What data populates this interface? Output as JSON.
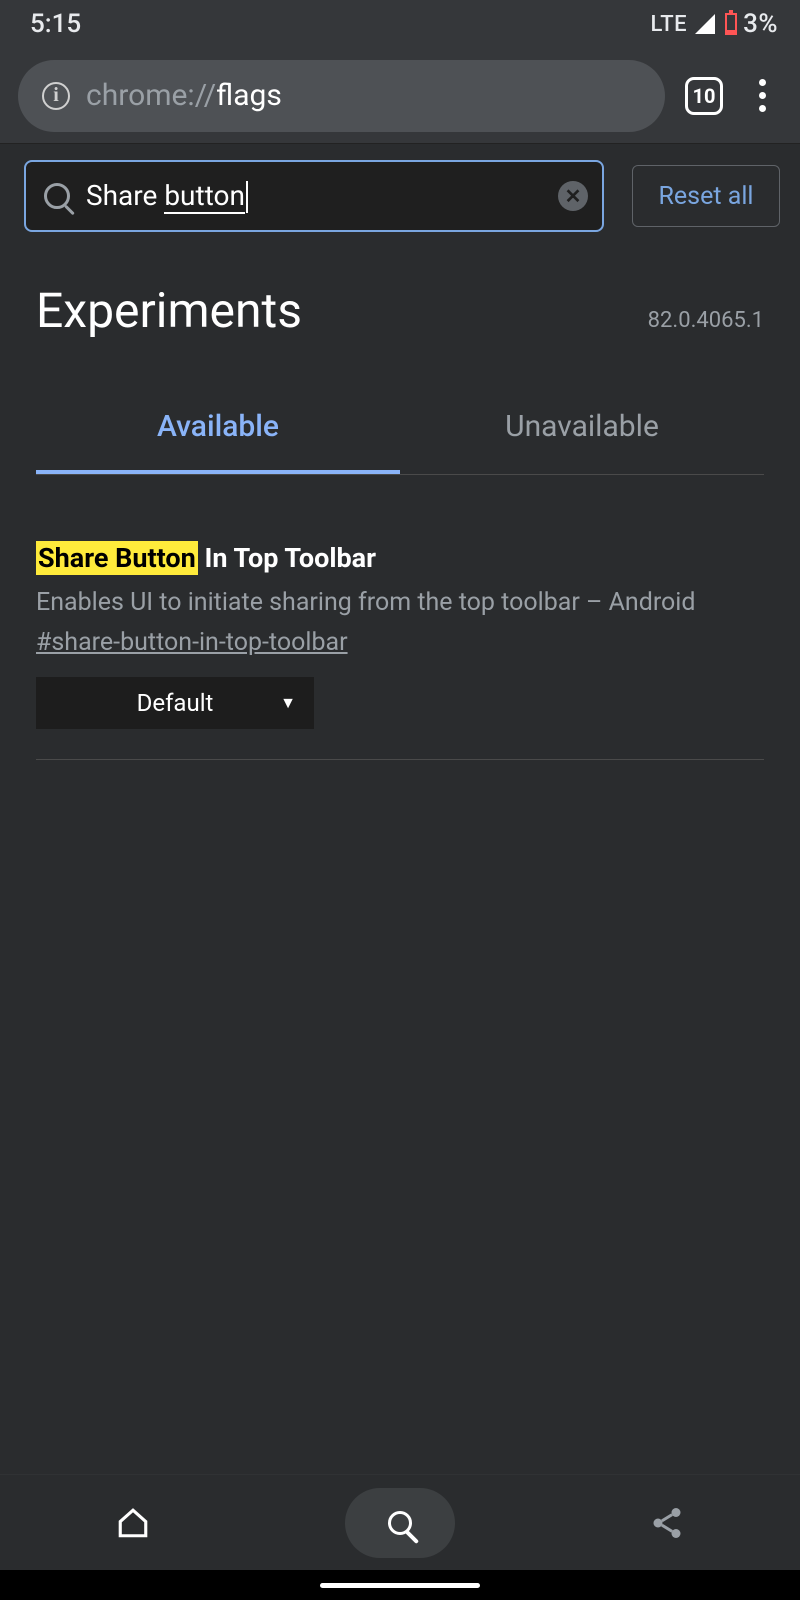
{
  "status": {
    "time": "5:15",
    "network": "LTE",
    "battery_pct": "3%"
  },
  "browser": {
    "url_prefix": "chrome://",
    "url_path": "flags",
    "tab_count": "10"
  },
  "search": {
    "text_plain": "Share ",
    "text_underlined": "button"
  },
  "reset_label": "Reset all",
  "page_title": "Experiments",
  "version": "82.0.4065.1",
  "tabs": {
    "available": "Available",
    "unavailable": "Unavailable"
  },
  "flag": {
    "title_highlight": "Share Button",
    "title_rest": " In Top Toolbar",
    "description": "Enables UI to initiate sharing from the top toolbar – Android",
    "id": "#share-button-in-top-toolbar",
    "selected": "Default"
  }
}
